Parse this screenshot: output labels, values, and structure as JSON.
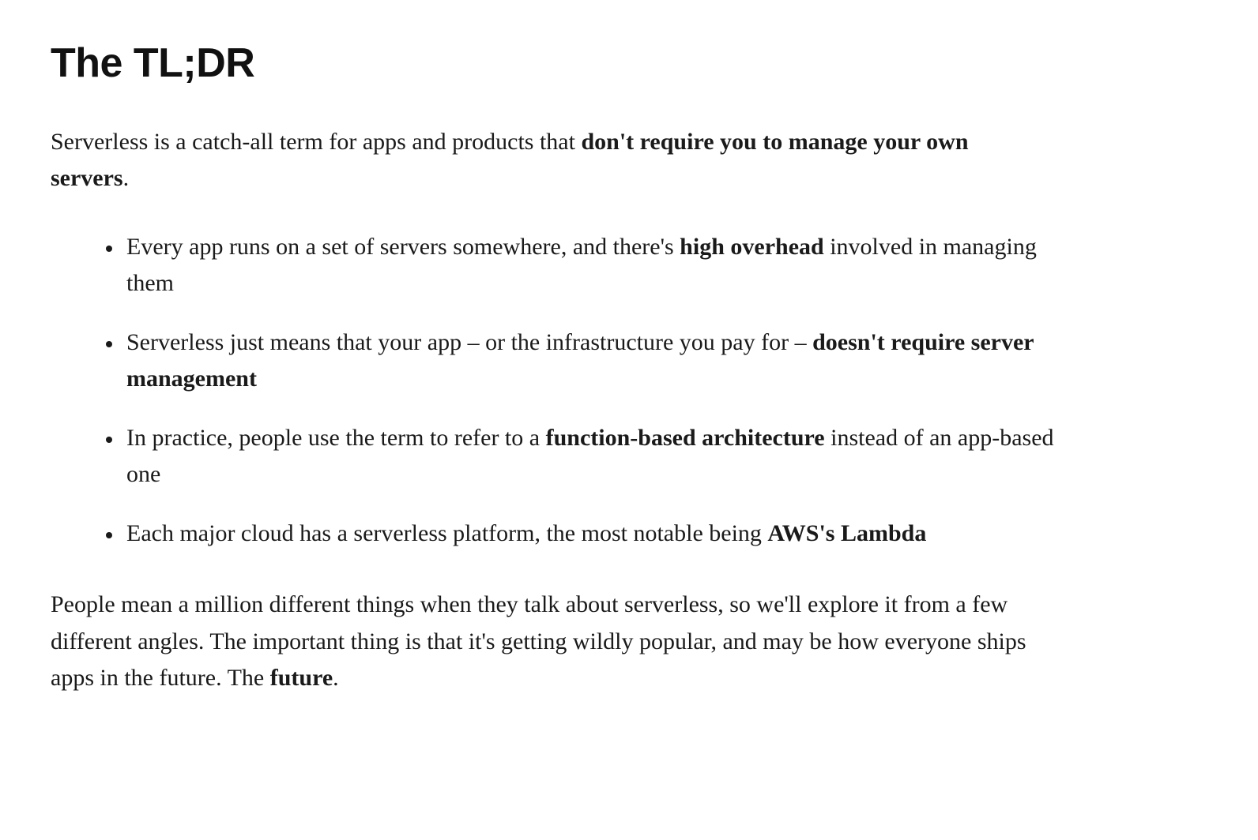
{
  "heading": "The TL;DR",
  "intro": {
    "pre": "Serverless is a catch-all term for apps and products that ",
    "bold": "don't require you to manage your own servers",
    "post": "."
  },
  "bullets": [
    {
      "pre": "Every app runs on a set of servers somewhere, and there's ",
      "bold": "high overhead",
      "post": " involved in managing them"
    },
    {
      "pre": "Serverless just means that your app – or the infrastructure you pay for – ",
      "bold": "doesn't require server management",
      "post": ""
    },
    {
      "pre": "In practice, people use the term to refer to a ",
      "bold": "function-based architecture",
      "post": " instead of an app-based one"
    },
    {
      "pre": "Each major cloud has a serverless platform, the most notable being ",
      "bold": "AWS's Lambda",
      "post": ""
    }
  ],
  "outro": {
    "pre": "People mean a million different things when they talk about serverless, so we'll explore it from a few different angles. The important thing is that it's getting wildly popular, and may be how everyone ships apps in the future. The ",
    "bold": "future",
    "post": "."
  }
}
